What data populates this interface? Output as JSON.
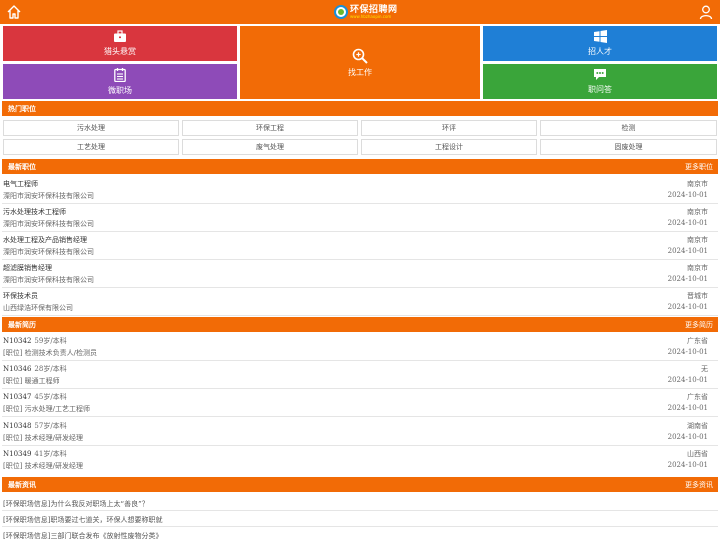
{
  "header": {
    "logo_name": "环保招聘网",
    "logo_url": "www.hbzhaopin.com",
    "home_icon": "home-icon",
    "user_icon": "user-icon"
  },
  "tiles": {
    "headhunt": {
      "label": "猎头悬赏",
      "icon": "briefcase-icon",
      "color": "#d9363e"
    },
    "find_job": {
      "label": "找工作",
      "icon": "search-icon",
      "color": "#f26b06"
    },
    "recruit": {
      "label": "招人才",
      "icon": "windows-icon",
      "color": "#1f7fd6"
    },
    "job_fair": {
      "label": "微职场",
      "icon": "document-icon",
      "color": "#8e4bb8"
    },
    "qa": {
      "label": "职问答",
      "icon": "chat-icon",
      "color": "#3aa53a"
    }
  },
  "hot_jobs": {
    "title": "热门职位",
    "tags": [
      "污水处理",
      "环保工程",
      "环评",
      "检测",
      "工艺处理",
      "废气处理",
      "工程设计",
      "固废处理"
    ]
  },
  "latest_jobs": {
    "title": "最新职位",
    "more": "更多职位",
    "items": [
      {
        "title": "电气工程师",
        "company": "溧阳市润安环保科技有限公司",
        "city": "南京市",
        "date": "2024-10-01"
      },
      {
        "title": "污水处理技术工程师",
        "company": "溧阳市润安环保科技有限公司",
        "city": "南京市",
        "date": "2024-10-01"
      },
      {
        "title": "水处理工程及产品销售经理",
        "company": "溧阳市润安环保科技有限公司",
        "city": "南京市",
        "date": "2024-10-01"
      },
      {
        "title": "超滤膜销售经理",
        "company": "溧阳市润安环保科技有限公司",
        "city": "南京市",
        "date": "2024-10-01"
      },
      {
        "title": "环保技术员",
        "company": "山西绿浩环保有限公司",
        "city": "晋城市",
        "date": "2024-10-01"
      }
    ]
  },
  "latest_resumes": {
    "title": "最新简历",
    "more": "更多简历",
    "items": [
      {
        "code": "N10342",
        "meta": "59岁/本科",
        "position": "[职位] 检测技术负责人/检测员",
        "region": "广东省",
        "date": "2024-10-01"
      },
      {
        "code": "N10346",
        "meta": "28岁/本科",
        "position": "[职位] 暖通工程师",
        "region": "无",
        "date": "2024-10-01"
      },
      {
        "code": "N10347",
        "meta": "45岁/本科",
        "position": "[职位] 污水处理/工艺工程师",
        "region": "广东省",
        "date": "2024-10-01"
      },
      {
        "code": "N10348",
        "meta": "57岁/本科",
        "position": "[职位] 技术经理/研发经理",
        "region": "湖南省",
        "date": "2024-10-01"
      },
      {
        "code": "N10349",
        "meta": "41岁/本科",
        "position": "[职位] 技术经理/研发经理",
        "region": "山西省",
        "date": "2024-10-01"
      }
    ]
  },
  "latest_news": {
    "title": "最新资讯",
    "more": "更多资讯",
    "items": [
      "[环保职场信息]为什么我反对职场上太“善良”？",
      "[环保职场信息]职场要过七道关，环保人想要称职就",
      "[环保职场信息]三部门联合发布《放射性废物分类》"
    ]
  }
}
